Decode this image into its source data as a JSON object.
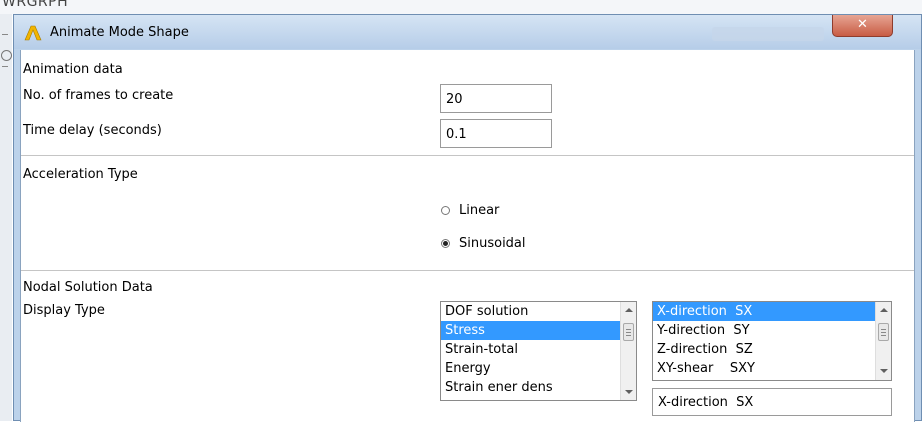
{
  "background": {
    "text": "WRGRPH"
  },
  "window": {
    "title": "Animate Mode Shape",
    "close_symbol": "✕",
    "accent": "#3399ff",
    "icon": "ansys-logo-icon"
  },
  "animation": {
    "heading": "Animation data",
    "frames_label": "No. of frames to create",
    "frames_value": "20",
    "delay_label": "Time delay (seconds)",
    "delay_value": "0.1"
  },
  "acceleration": {
    "heading": "Acceleration Type",
    "options": [
      {
        "label": "Linear",
        "checked": false
      },
      {
        "label": "Sinusoidal",
        "checked": true
      }
    ]
  },
  "nodal": {
    "heading": "Nodal Solution Data",
    "display_label": "Display Type",
    "types": [
      "DOF solution",
      "Stress",
      "Strain-total",
      "Energy",
      "Strain ener dens"
    ],
    "types_selected": 1,
    "components": [
      "X-direction  SX",
      "Y-direction  SY",
      "Z-direction  SZ",
      "XY-shear    SXY"
    ],
    "components_selected": 0,
    "selected_value": "X-direction  SX"
  }
}
